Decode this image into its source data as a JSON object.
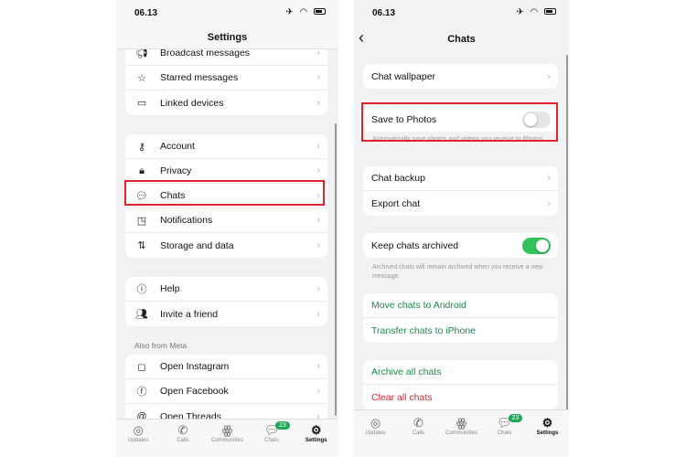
{
  "left": {
    "time": "06.13",
    "title": "Settings",
    "group1": [
      {
        "icon": "megaphone-icon",
        "label": "Broadcast messages"
      },
      {
        "icon": "star-icon",
        "label": "Starred messages"
      },
      {
        "icon": "laptop-icon",
        "label": "Linked devices"
      }
    ],
    "group2": [
      {
        "icon": "key-icon",
        "label": "Account"
      },
      {
        "icon": "lock-icon",
        "label": "Privacy"
      },
      {
        "icon": "chat-bubble-icon",
        "label": "Chats"
      },
      {
        "icon": "notification-icon",
        "label": "Notifications"
      },
      {
        "icon": "arrows-updown-icon",
        "label": "Storage and data"
      }
    ],
    "group3": [
      {
        "icon": "info-icon",
        "label": "Help"
      },
      {
        "icon": "people-icon",
        "label": "Invite a friend"
      }
    ],
    "meta_header": "Also from Meta",
    "group4": [
      {
        "icon": "instagram-icon",
        "label": "Open Instagram"
      },
      {
        "icon": "facebook-icon",
        "label": "Open Facebook"
      },
      {
        "icon": "threads-icon",
        "label": "Open Threads"
      }
    ]
  },
  "right": {
    "time": "06.13",
    "title": "Chats",
    "chat_wallpaper": "Chat wallpaper",
    "save_to_photos": {
      "label": "Save to Photos",
      "on": false,
      "caption": "Automatically save photos and videos you receive to Photos."
    },
    "chat_backup": "Chat backup",
    "export_chat": "Export chat",
    "keep_archived": {
      "label": "Keep chats archived",
      "on": true,
      "caption": "Archived chats will remain archived when you receive a new message."
    },
    "move_android": "Move chats to Android",
    "transfer_iphone": "Transfer chats to iPhone",
    "archive_all": "Archive all chats",
    "clear_all": "Clear all chats"
  },
  "tabs": [
    {
      "label": "Updates",
      "icon": "updates-icon"
    },
    {
      "label": "Calls",
      "icon": "phone-icon"
    },
    {
      "label": "Communities",
      "icon": "communities-icon"
    },
    {
      "label": "Chats",
      "icon": "chats-icon",
      "badge": "23"
    },
    {
      "label": "Settings",
      "icon": "settings-icon",
      "active": true
    }
  ],
  "colors": {
    "accent": "#1fa855",
    "link_green": "#1a8a4a",
    "destructive": "#e0243a",
    "highlight_box": "#e0242f"
  }
}
